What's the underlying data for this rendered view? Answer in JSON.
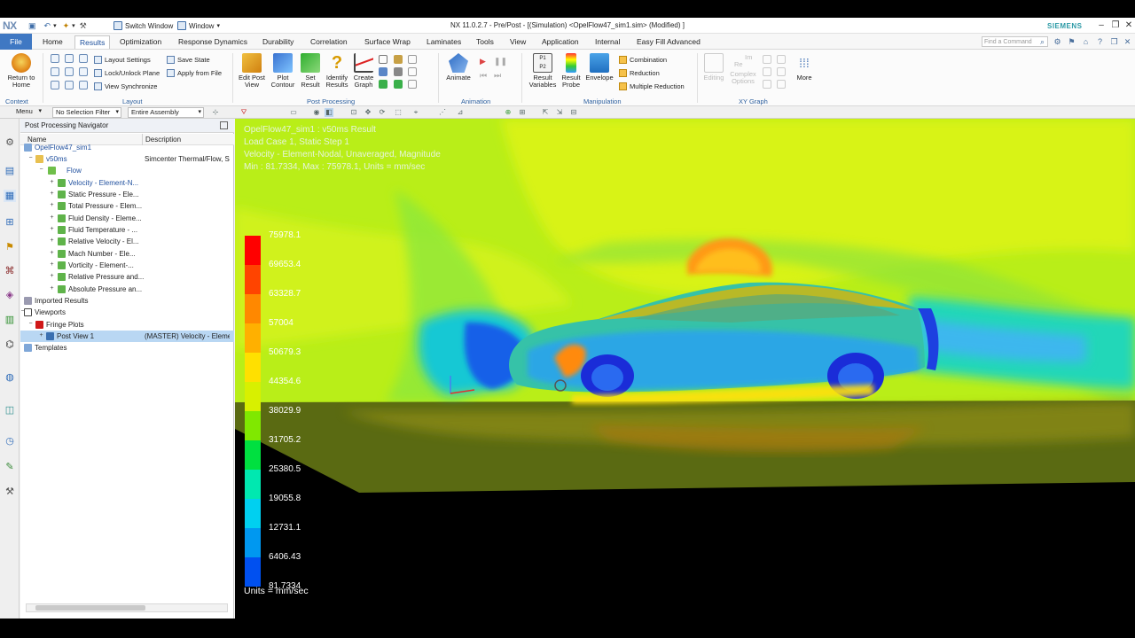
{
  "titlebar": {
    "logo": "NX",
    "switch_window": "Switch Window",
    "window_menu": "Window",
    "title": "NX 11.0.2.7 - Pre/Post - [(Simulation) <OpelFlow47_sim1.sim> (Modified) ]",
    "brand": "SIEMENS"
  },
  "tabs": {
    "file": "File",
    "items": [
      "Home",
      "Results",
      "Optimization",
      "Response Dynamics",
      "Durability",
      "Correlation",
      "Surface Wrap",
      "Laminates",
      "Tools",
      "View",
      "Application",
      "Internal",
      "Easy Fill Advanced"
    ],
    "active": "Results",
    "find_placeholder": "Find a Command"
  },
  "ribbon": {
    "return_home": "Return to Home",
    "context_label": "Context",
    "layout_settings": "Layout Settings",
    "lock_unlock": "Lock/Unlock Plane",
    "view_sync": "View Synchronize",
    "save_state": "Save State",
    "apply_from_file": "Apply from File",
    "layout_label": "Layout",
    "edit_post_view": "Edit Post View",
    "plot_contour": "Plot Contour",
    "set_result": "Set Result",
    "identify_results": "Identify Results",
    "create_graph": "Create Graph",
    "post_processing_label": "Post Processing",
    "animate": "Animate",
    "animation_label": "Animation",
    "result_variables": "Result Variables",
    "result_probe": "Result Probe",
    "envelope": "Envelope",
    "combination": "Combination",
    "reduction": "Reduction",
    "multiple_reduction": "Multiple Reduction",
    "manipulation_label": "Manipulation",
    "editing": "Editing",
    "re": "Re",
    "complex_options": "Complex Options",
    "im": "Im",
    "xy_graph_label": "XY Graph",
    "more": "More"
  },
  "filterbar": {
    "menu": "Menu",
    "selection_filter": "No Selection Filter",
    "assembly": "Entire Assembly"
  },
  "navigator": {
    "title": "Post Processing Navigator",
    "col_name": "Name",
    "col_desc": "Description",
    "rows": [
      {
        "label": "OpelFlow47_sim1",
        "desc": ""
      },
      {
        "label": "v50ms",
        "desc": "Simcenter Thermal/Flow, S"
      },
      {
        "label": "Flow",
        "desc": ""
      },
      {
        "label": "Velocity - Element-N...",
        "desc": ""
      },
      {
        "label": "Static Pressure - Ele...",
        "desc": ""
      },
      {
        "label": "Total Pressure - Elem...",
        "desc": ""
      },
      {
        "label": "Fluid Density - Eleme...",
        "desc": ""
      },
      {
        "label": "Fluid Temperature - ...",
        "desc": ""
      },
      {
        "label": "Relative Velocity - El...",
        "desc": ""
      },
      {
        "label": "Mach Number - Ele...",
        "desc": ""
      },
      {
        "label": "Vorticity - Element-...",
        "desc": ""
      },
      {
        "label": "Relative Pressure and...",
        "desc": ""
      },
      {
        "label": "Absolute Pressure an...",
        "desc": ""
      },
      {
        "label": "Imported Results",
        "desc": ""
      },
      {
        "label": "Viewports",
        "desc": ""
      },
      {
        "label": "Fringe Plots",
        "desc": ""
      },
      {
        "label": "Post View 1",
        "desc": "(MASTER) Velocity - Eleme"
      },
      {
        "label": "Templates",
        "desc": ""
      }
    ]
  },
  "viewport": {
    "line1": "OpelFlow47_sim1 : v50ms Result",
    "line2": "Load Case 1, Static Step 1",
    "line3": "Velocity - Element-Nodal, Unaveraged, Magnitude",
    "line4": "Min : 81.7334, Max : 75978.1, Units = mm/sec",
    "units": "Units = mm/sec",
    "legend_values": [
      "75978.1",
      "69653.4",
      "63328.7",
      "57004",
      "50679.3",
      "44354.6",
      "38029.9",
      "31705.2",
      "25380.5",
      "19055.8",
      "12731.1",
      "6406.43",
      "81.7334"
    ],
    "legend_colors": [
      "#ff0000",
      "#ff4400",
      "#ff8800",
      "#ffb000",
      "#ffe000",
      "#d8f000",
      "#80e800",
      "#00e040",
      "#00e8b0",
      "#00d0f0",
      "#0098f0",
      "#0050f0",
      "#0010e0"
    ]
  }
}
